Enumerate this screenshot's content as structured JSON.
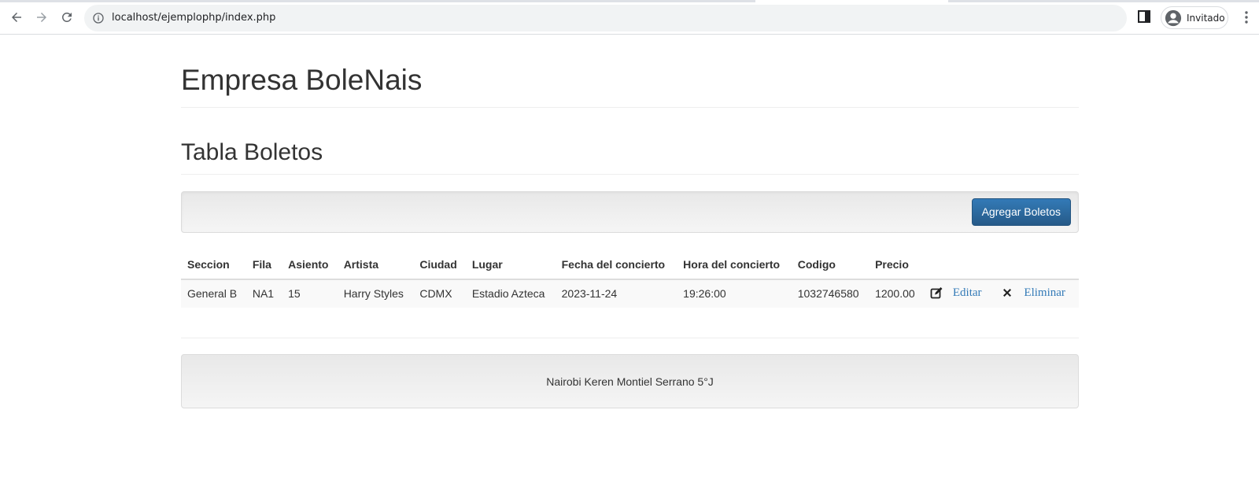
{
  "browser": {
    "url": "localhost/ejemplophp/index.php",
    "profile_name": "Invitado"
  },
  "page": {
    "company_title": "Empresa BoleNais",
    "section_title": "Tabla Boletos",
    "add_button_label": "Agregar Boletos"
  },
  "table": {
    "headers": [
      "Seccion",
      "Fila",
      "Asiento",
      "Artista",
      "Ciudad",
      "Lugar",
      "Fecha del concierto",
      "Hora del concierto",
      "Codigo",
      "Precio"
    ],
    "rows": [
      {
        "seccion": "General B",
        "fila": "NA1",
        "asiento": "15",
        "artista": "Harry Styles",
        "ciudad": "CDMX",
        "lugar": "Estadio Azteca",
        "fecha": "2023-11-24",
        "hora": "19:26:00",
        "codigo": "1032746580",
        "precio": "1200.00",
        "edit_label": "Editar",
        "delete_label": "Eliminar"
      }
    ]
  },
  "footer": {
    "text": "Nairobi Keren Montiel Serrano 5°J"
  },
  "colors": {
    "primary": "#337ab7",
    "link": "#337ab7"
  }
}
